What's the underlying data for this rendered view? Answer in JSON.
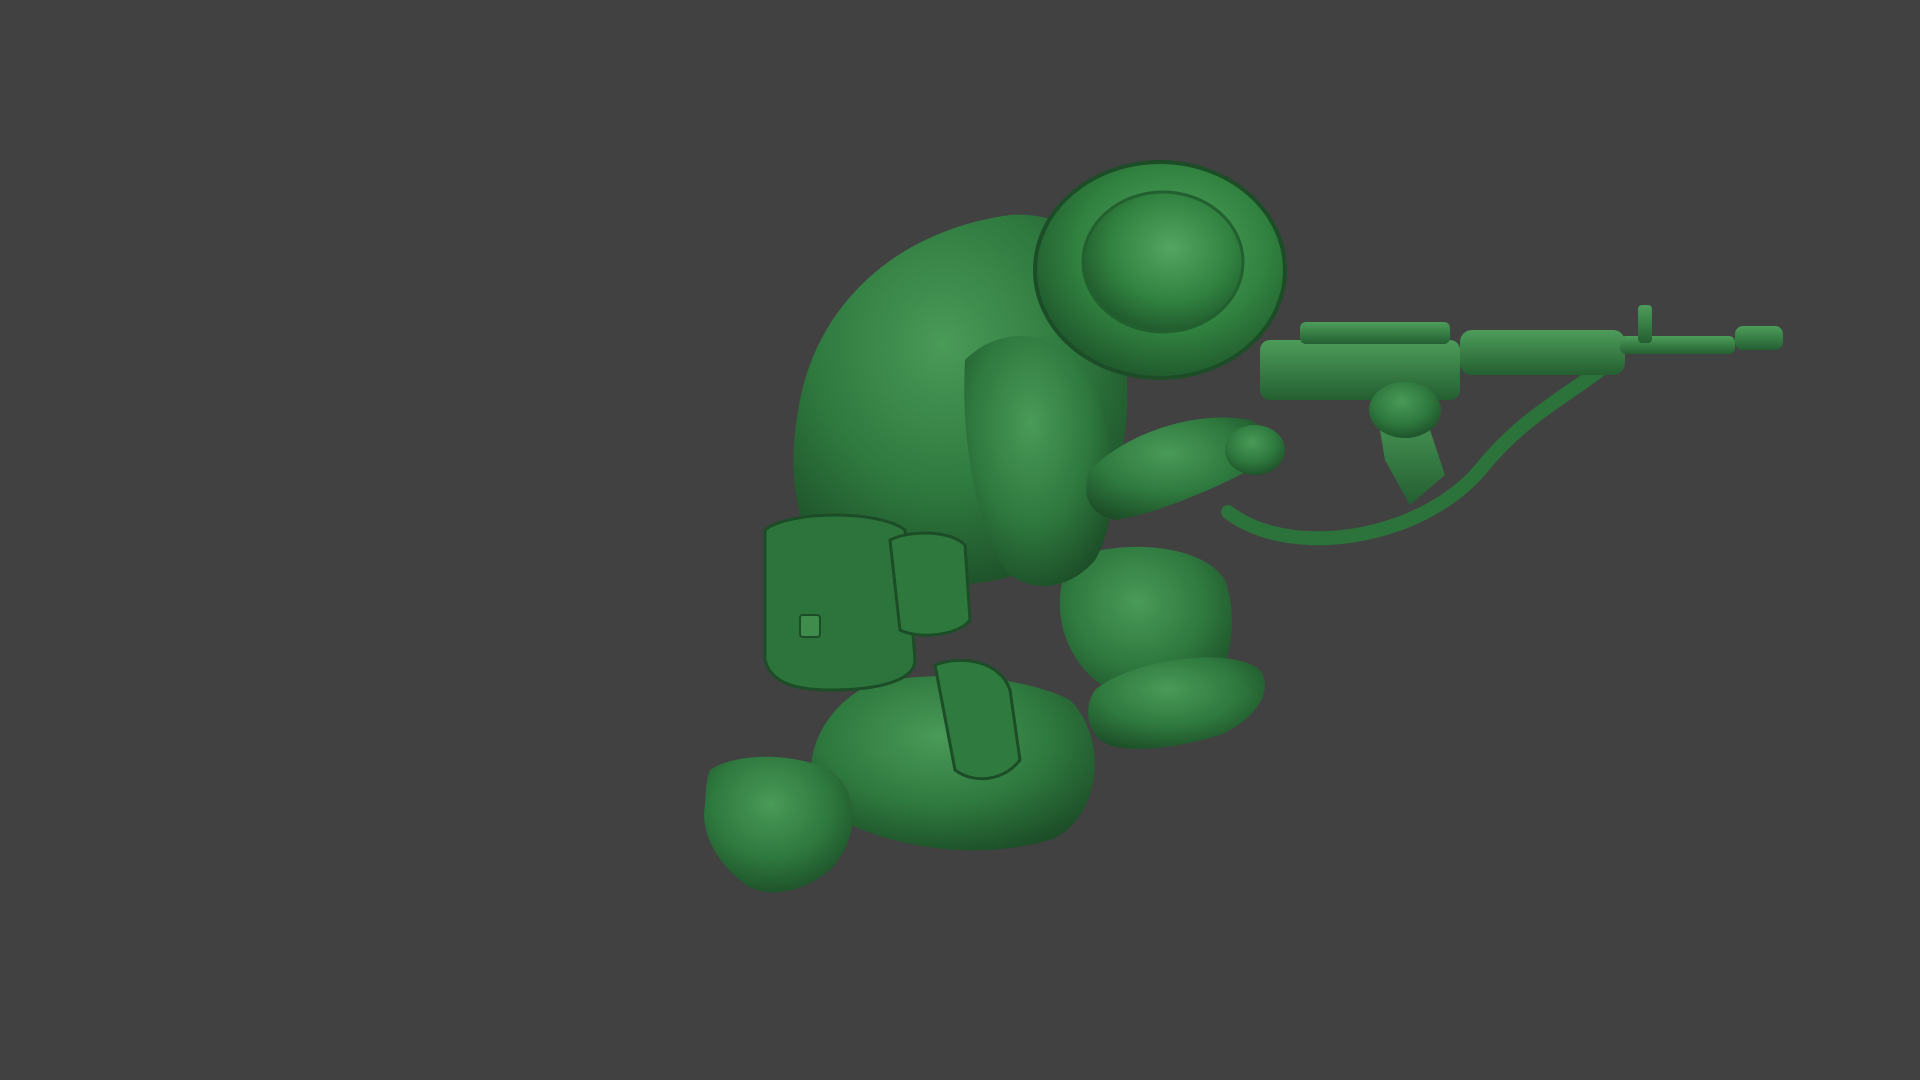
{
  "scene": {
    "background_color": "#414141",
    "model_color": "#2f7a3f",
    "model_highlight": "#4a9a58",
    "model_shadow": "#1c4d27"
  }
}
